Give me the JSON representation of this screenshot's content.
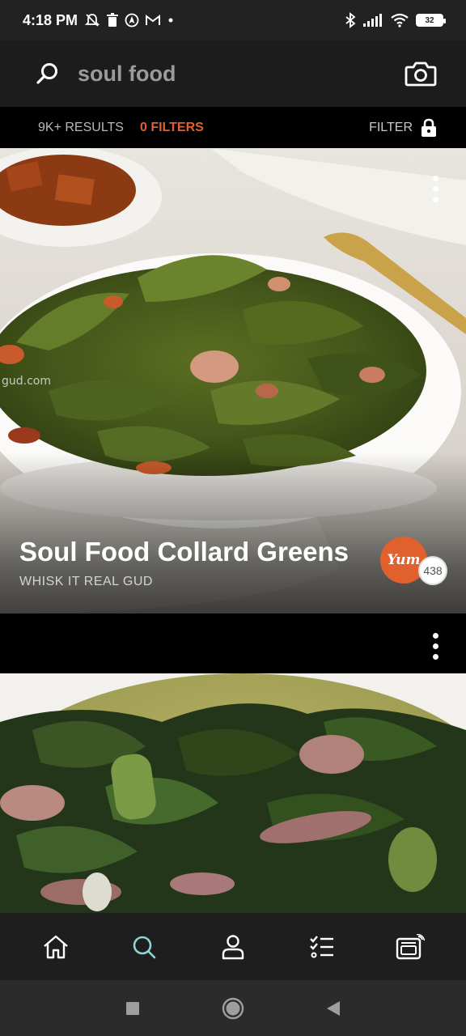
{
  "status_bar": {
    "time": "4:18 PM",
    "battery": "32",
    "left_icons": [
      "mute-bell-icon",
      "trash-icon",
      "navigation-icon",
      "gmail-icon",
      "dot-icon"
    ],
    "right_icons": [
      "bluetooth-icon",
      "signal-icon",
      "wifi-icon",
      "battery-icon"
    ]
  },
  "search": {
    "query": "soul food",
    "icon": "search-icon",
    "camera_icon": "camera-icon"
  },
  "results_bar": {
    "results_label": "9K+ RESULTS",
    "filters_label": "0 FILTERS",
    "filter_button_label": "FILTER",
    "filter_icon": "lock-icon"
  },
  "cards": [
    {
      "title": "Soul Food Collard Greens",
      "source": "WHISK IT REAL GUD",
      "badge_label": "Yum",
      "yum_count": "438",
      "photo_watermark": "gud.com"
    }
  ],
  "bottom_nav": {
    "items": [
      {
        "name": "home",
        "icon": "home-icon"
      },
      {
        "name": "search",
        "icon": "search-icon",
        "active": true
      },
      {
        "name": "profile",
        "icon": "profile-icon"
      },
      {
        "name": "shopping-list",
        "icon": "checklist-icon"
      },
      {
        "name": "smart-appliance",
        "icon": "oven-icon"
      }
    ]
  },
  "colors": {
    "accent": "#e0612e",
    "active_nav": "#8fd4d8",
    "bar_bg": "#1c1c1c"
  }
}
